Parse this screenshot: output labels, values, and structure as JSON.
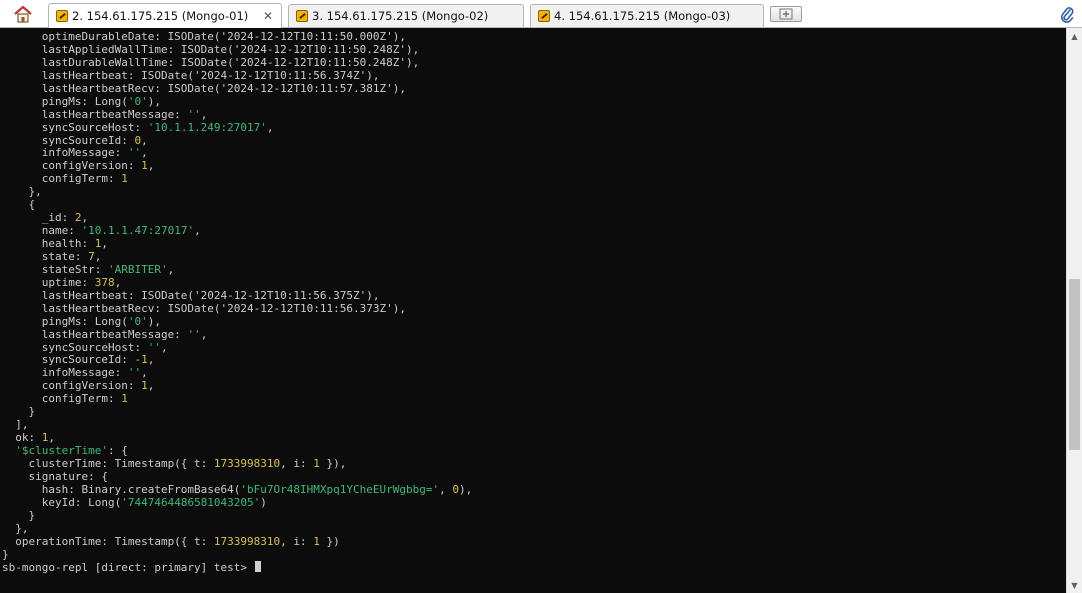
{
  "tabs": [
    {
      "label": "2. 154.61.175.215 (Mongo-01)",
      "active": true
    },
    {
      "label": "3. 154.61.175.215 (Mongo-02)",
      "active": false
    },
    {
      "label": "4. 154.61.175.215 (Mongo-03)",
      "active": false
    }
  ],
  "tab_close_glyph": "✕",
  "icons": {
    "home": "home-icon",
    "tab": "terminal-session-icon",
    "new_tab": "add-tab-icon",
    "attach": "paperclip-icon"
  },
  "colors": {
    "terminal_bg": "#0c0c0c",
    "text": "#cccccc",
    "string": "#3cba78",
    "number": "#d8c244"
  },
  "terminal": {
    "lines": [
      [
        {
          "t": "      optimeDurableDate: ISODate('2024-12-12T10:11:50.000Z'),"
        }
      ],
      [
        {
          "t": "      lastAppliedWallTime: ISODate('2024-12-12T10:11:50.248Z'),"
        }
      ],
      [
        {
          "t": "      lastDurableWallTime: ISODate('2024-12-12T10:11:50.248Z'),"
        }
      ],
      [
        {
          "t": "      lastHeartbeat: ISODate('2024-12-12T10:11:56.374Z'),"
        }
      ],
      [
        {
          "t": "      lastHeartbeatRecv: ISODate('2024-12-12T10:11:57.381Z'),"
        }
      ],
      [
        {
          "t": "      pingMs: Long("
        },
        {
          "t": "'0'",
          "c": "str"
        },
        {
          "t": "),"
        }
      ],
      [
        {
          "t": "      lastHeartbeatMessage: "
        },
        {
          "t": "''",
          "c": "str"
        },
        {
          "t": ","
        }
      ],
      [
        {
          "t": "      syncSourceHost: "
        },
        {
          "t": "'10.1.1.249:27017'",
          "c": "str"
        },
        {
          "t": ","
        }
      ],
      [
        {
          "t": "      syncSourceId: "
        },
        {
          "t": "0",
          "c": "num"
        },
        {
          "t": ","
        }
      ],
      [
        {
          "t": "      infoMessage: "
        },
        {
          "t": "''",
          "c": "str"
        },
        {
          "t": ","
        }
      ],
      [
        {
          "t": "      configVersion: "
        },
        {
          "t": "1",
          "c": "num"
        },
        {
          "t": ","
        }
      ],
      [
        {
          "t": "      configTerm: "
        },
        {
          "t": "1",
          "c": "num"
        }
      ],
      [
        {
          "t": "    },"
        }
      ],
      [
        {
          "t": "    {"
        }
      ],
      [
        {
          "t": "      _id: "
        },
        {
          "t": "2",
          "c": "num"
        },
        {
          "t": ","
        }
      ],
      [
        {
          "t": "      name: "
        },
        {
          "t": "'10.1.1.47:27017'",
          "c": "str"
        },
        {
          "t": ","
        }
      ],
      [
        {
          "t": "      health: "
        },
        {
          "t": "1",
          "c": "num"
        },
        {
          "t": ","
        }
      ],
      [
        {
          "t": "      state: "
        },
        {
          "t": "7",
          "c": "num"
        },
        {
          "t": ","
        }
      ],
      [
        {
          "t": "      stateStr: "
        },
        {
          "t": "'ARBITER'",
          "c": "str"
        },
        {
          "t": ","
        }
      ],
      [
        {
          "t": "      uptime: "
        },
        {
          "t": "378",
          "c": "num"
        },
        {
          "t": ","
        }
      ],
      [
        {
          "t": "      lastHeartbeat: ISODate('2024-12-12T10:11:56.375Z'),"
        }
      ],
      [
        {
          "t": "      lastHeartbeatRecv: ISODate('2024-12-12T10:11:56.373Z'),"
        }
      ],
      [
        {
          "t": "      pingMs: Long("
        },
        {
          "t": "'0'",
          "c": "str"
        },
        {
          "t": "),"
        }
      ],
      [
        {
          "t": "      lastHeartbeatMessage: "
        },
        {
          "t": "''",
          "c": "str"
        },
        {
          "t": ","
        }
      ],
      [
        {
          "t": "      syncSourceHost: "
        },
        {
          "t": "''",
          "c": "str"
        },
        {
          "t": ","
        }
      ],
      [
        {
          "t": "      syncSourceId: "
        },
        {
          "t": "-1",
          "c": "num"
        },
        {
          "t": ","
        }
      ],
      [
        {
          "t": "      infoMessage: "
        },
        {
          "t": "''",
          "c": "str"
        },
        {
          "t": ","
        }
      ],
      [
        {
          "t": "      configVersion: "
        },
        {
          "t": "1",
          "c": "num"
        },
        {
          "t": ","
        }
      ],
      [
        {
          "t": "      configTerm: "
        },
        {
          "t": "1",
          "c": "num"
        }
      ],
      [
        {
          "t": "    }"
        }
      ],
      [
        {
          "t": "  ],"
        }
      ],
      [
        {
          "t": "  ok: "
        },
        {
          "t": "1",
          "c": "num"
        },
        {
          "t": ","
        }
      ],
      [
        {
          "t": "  "
        },
        {
          "t": "'$clusterTime'",
          "c": "str"
        },
        {
          "t": ": {"
        }
      ],
      [
        {
          "t": "    clusterTime: Timestamp({ t: "
        },
        {
          "t": "1733998310",
          "c": "num"
        },
        {
          "t": ", i: "
        },
        {
          "t": "1",
          "c": "num"
        },
        {
          "t": " }),"
        }
      ],
      [
        {
          "t": "    signature: {"
        }
      ],
      [
        {
          "t": "      hash: Binary.createFromBase64("
        },
        {
          "t": "'bFu7Or48IHMXpq1YCheEUrWgbbg='",
          "c": "str"
        },
        {
          "t": ", "
        },
        {
          "t": "0",
          "c": "num"
        },
        {
          "t": "),"
        }
      ],
      [
        {
          "t": "      keyId: Long("
        },
        {
          "t": "'7447464486581043205'",
          "c": "str"
        },
        {
          "t": ")"
        }
      ],
      [
        {
          "t": "    }"
        }
      ],
      [
        {
          "t": "  },"
        }
      ],
      [
        {
          "t": "  operationTime: Timestamp({ t: "
        },
        {
          "t": "1733998310",
          "c": "num"
        },
        {
          "t": ", i: "
        },
        {
          "t": "1",
          "c": "num"
        },
        {
          "t": " })"
        }
      ],
      [
        {
          "t": "}"
        }
      ],
      [
        {
          "t": "sb-mongo-repl [direct: primary] test> "
        }
      ]
    ]
  },
  "scrollbar": {
    "position_fraction": 0.65,
    "visible_fraction": 0.32
  }
}
